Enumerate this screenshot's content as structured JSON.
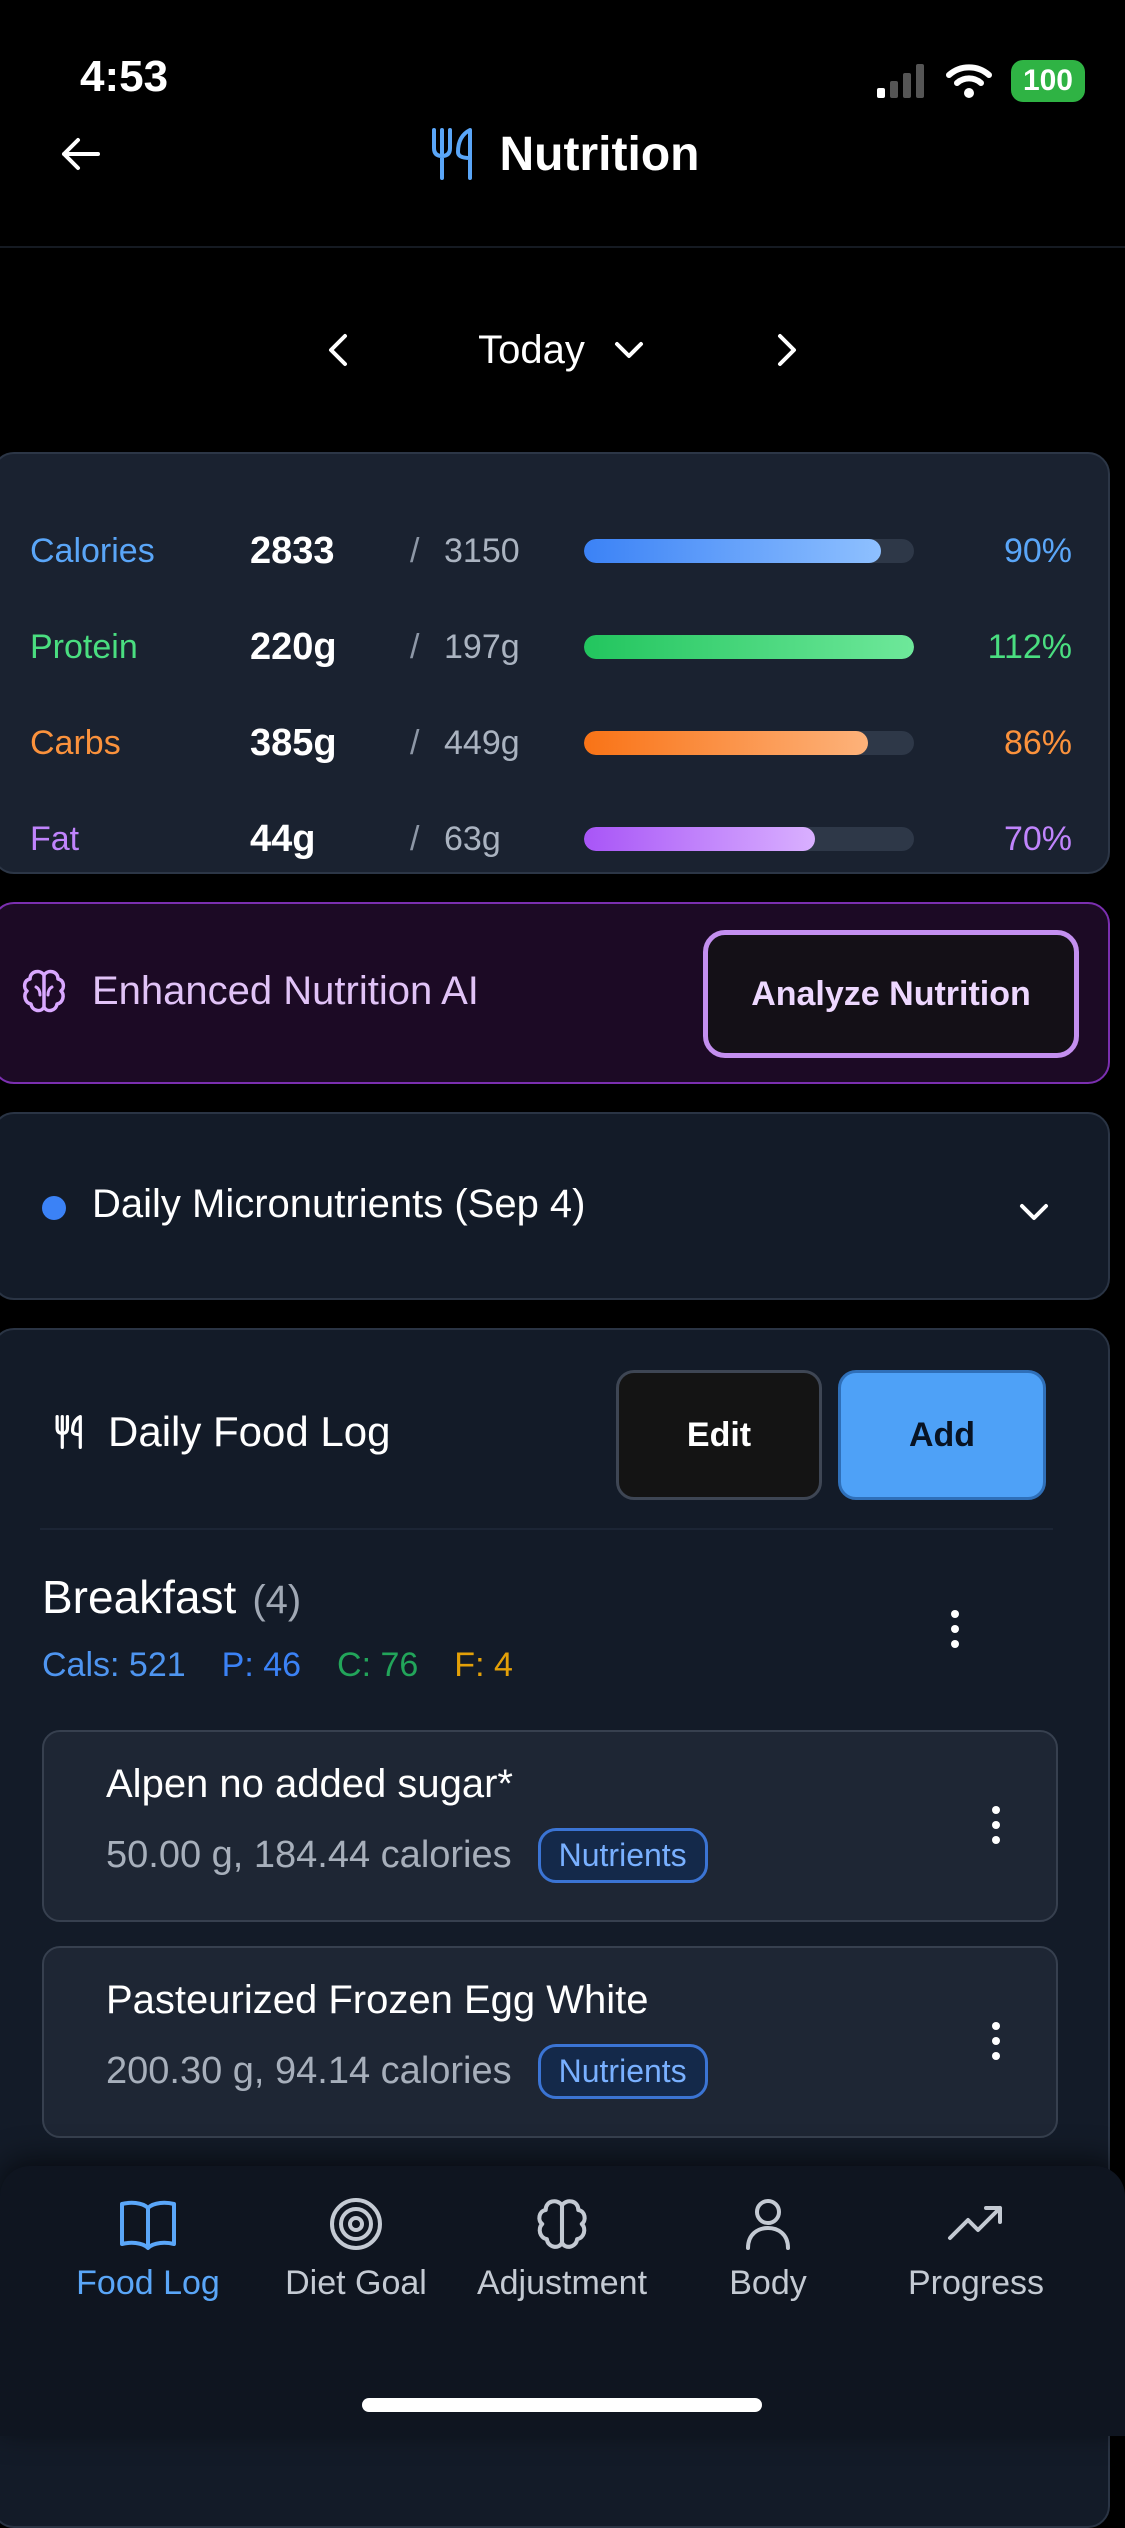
{
  "status": {
    "time": "4:53",
    "battery": "100"
  },
  "header": {
    "title": "Nutrition"
  },
  "date_nav": {
    "label": "Today"
  },
  "macros": [
    {
      "name": "Calories",
      "value": "2833",
      "goal": "3150",
      "percent_label": "90%",
      "progress": 0.9,
      "color": "#5aa6f8",
      "bar_from": "#3b82f6",
      "bar_to": "#8ec0ff"
    },
    {
      "name": "Protein",
      "value": "220g",
      "goal": "197g",
      "percent_label": "112%",
      "progress": 1.0,
      "color": "#4ade80",
      "bar_from": "#22c55e",
      "bar_to": "#6ee89a"
    },
    {
      "name": "Carbs",
      "value": "385g",
      "goal": "449g",
      "percent_label": "86%",
      "progress": 0.86,
      "color": "#fb923c",
      "bar_from": "#f97316",
      "bar_to": "#fdb27a"
    },
    {
      "name": "Fat",
      "value": "44g",
      "goal": "63g",
      "percent_label": "70%",
      "progress": 0.7,
      "color": "#c084fc",
      "bar_from": "#a855f7",
      "bar_to": "#d9b0ff"
    }
  ],
  "ai": {
    "label": "Enhanced Nutrition AI",
    "button": "Analyze Nutrition"
  },
  "micronutrients": {
    "label": "Daily Micronutrients (Sep 4)"
  },
  "food_log": {
    "title": "Daily Food Log",
    "edit_label": "Edit",
    "add_label": "Add",
    "meal": {
      "name": "Breakfast",
      "count": "(4)",
      "cals": "Cals: 521",
      "p": "P: 46",
      "c": "C: 76",
      "f": "F: 4"
    },
    "items": [
      {
        "name": "Alpen no added sugar*",
        "detail": "50.00 g, 184.44 calories",
        "badge": "Nutrients"
      },
      {
        "name": "Pasteurized Frozen Egg White",
        "detail": "200.30 g, 94.14 calories",
        "badge": "Nutrients"
      }
    ]
  },
  "nav": [
    {
      "label": "Food Log",
      "icon": "book-icon",
      "active": true
    },
    {
      "label": "Diet Goal",
      "icon": "target-icon",
      "active": false
    },
    {
      "label": "Adjustment",
      "icon": "brain-icon",
      "active": false
    },
    {
      "label": "Body",
      "icon": "person-icon",
      "active": false
    },
    {
      "label": "Progress",
      "icon": "trending-up-icon",
      "active": false
    }
  ],
  "colors": {
    "accent": "#4ea1f7",
    "ai_purple": "#c48ff0"
  }
}
